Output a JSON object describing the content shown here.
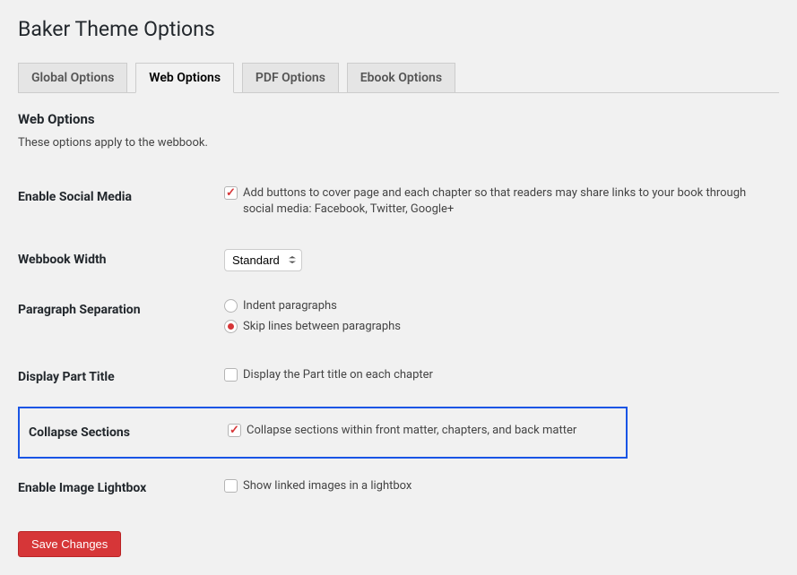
{
  "page_title": "Baker Theme Options",
  "tabs": [
    {
      "label": "Global Options",
      "active": false
    },
    {
      "label": "Web Options",
      "active": true
    },
    {
      "label": "PDF Options",
      "active": false
    },
    {
      "label": "Ebook Options",
      "active": false
    }
  ],
  "section": {
    "title": "Web Options",
    "description": "These options apply to the webbook."
  },
  "fields": {
    "social_media": {
      "label": "Enable Social Media",
      "checkbox_label": "Add buttons to cover page and each chapter so that readers may share links to your book through social media: Facebook, Twitter, Google+",
      "checked": true
    },
    "webbook_width": {
      "label": "Webbook Width",
      "selected": "Standard"
    },
    "paragraph_separation": {
      "label": "Paragraph Separation",
      "options": [
        {
          "label": "Indent paragraphs",
          "checked": false
        },
        {
          "label": "Skip lines between paragraphs",
          "checked": true
        }
      ]
    },
    "display_part_title": {
      "label": "Display Part Title",
      "checkbox_label": "Display the Part title on each chapter",
      "checked": false
    },
    "collapse_sections": {
      "label": "Collapse Sections",
      "checkbox_label": "Collapse sections within front matter, chapters, and back matter",
      "checked": true
    },
    "image_lightbox": {
      "label": "Enable Image Lightbox",
      "checkbox_label": "Show linked images in a lightbox",
      "checked": false
    }
  },
  "submit_label": "Save Changes"
}
